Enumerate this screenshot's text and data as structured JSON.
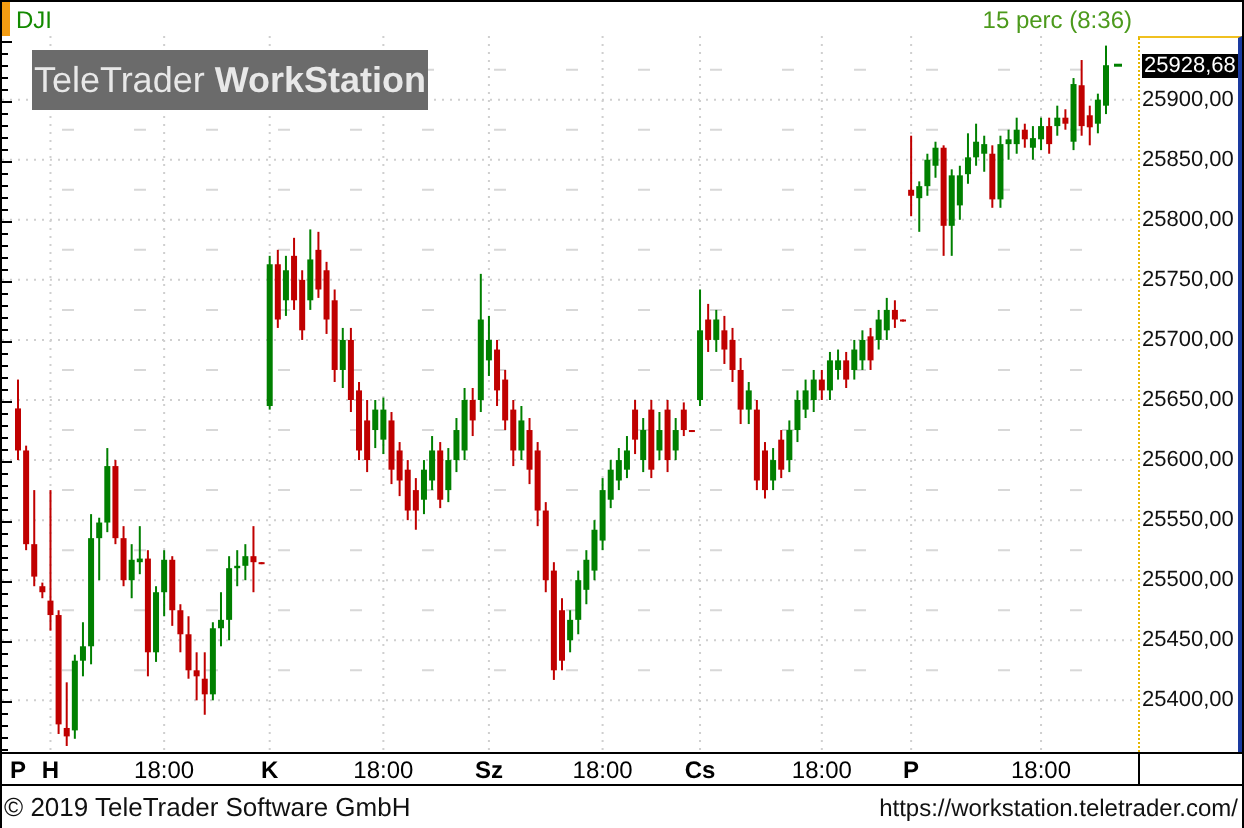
{
  "header": {
    "symbol": "DJI",
    "period": "15 perc (8:36)"
  },
  "logo": "TeleTrader **WorkStation**",
  "last_price": "25928,68",
  "chart": {
    "chart_data": {
      "type": "candlestick",
      "grid": true,
      "ylim": [
        25357,
        25953
      ],
      "yticks": [
        {
          "value": 25400,
          "label": "25400,00"
        },
        {
          "value": 25450,
          "label": "25450,00"
        },
        {
          "value": 25500,
          "label": "25500,00"
        },
        {
          "value": 25550,
          "label": "25550,00"
        },
        {
          "value": 25600,
          "label": "25600,00"
        },
        {
          "value": 25650,
          "label": "25650,00"
        },
        {
          "value": 25700,
          "label": "25700,00"
        },
        {
          "value": 25750,
          "label": "25750,00"
        },
        {
          "value": 25800,
          "label": "25800,00"
        },
        {
          "value": 25850,
          "label": "25850,00"
        },
        {
          "value": 25900,
          "label": "25900,00"
        }
      ],
      "categories": [
        "P",
        null,
        null,
        null,
        "H",
        null,
        null,
        null,
        null,
        null,
        null,
        null,
        null,
        null,
        null,
        null,
        null,
        null,
        "18:00",
        null,
        null,
        null,
        null,
        null,
        null,
        null,
        null,
        null,
        null,
        null,
        null,
        "K",
        null,
        null,
        null,
        null,
        null,
        null,
        null,
        null,
        null,
        null,
        null,
        null,
        null,
        "18:00",
        null,
        null,
        null,
        null,
        null,
        null,
        null,
        null,
        null,
        null,
        null,
        null,
        "Sz",
        null,
        null,
        null,
        null,
        null,
        null,
        null,
        null,
        null,
        null,
        null,
        null,
        null,
        "18:00",
        null,
        null,
        null,
        null,
        null,
        null,
        null,
        null,
        null,
        null,
        null,
        "Cs",
        null,
        null,
        null,
        null,
        null,
        null,
        null,
        null,
        null,
        null,
        null,
        null,
        null,
        null,
        "18:00",
        null,
        null,
        null,
        null,
        null,
        null,
        null,
        null,
        null,
        null,
        "P",
        null,
        null,
        null,
        null,
        null,
        null,
        null,
        null,
        null,
        null,
        null,
        null,
        null,
        null,
        null,
        "18:00",
        null,
        null,
        null,
        null,
        null,
        null,
        null,
        null
      ],
      "ohlc": [
        [
          25643,
          25667,
          25600,
          25608
        ],
        [
          25608,
          25612,
          25525,
          25530
        ],
        [
          25530,
          25575,
          25495,
          25503
        ],
        [
          25495,
          25498,
          25485,
          25490
        ],
        [
          25483,
          25575,
          25458,
          25471
        ],
        [
          25471,
          25475,
          25372,
          25380
        ],
        [
          25377,
          25415,
          25362,
          25370
        ],
        [
          25375,
          25438,
          25368,
          25433
        ],
        [
          25433,
          25465,
          25420,
          25445
        ],
        [
          25445,
          25555,
          25430,
          25535
        ],
        [
          25535,
          25552,
          25500,
          25548
        ],
        [
          25548,
          25610,
          25540,
          25595
        ],
        [
          25595,
          25600,
          25530,
          25535
        ],
        [
          25535,
          25545,
          25495,
          25500
        ],
        [
          25500,
          25530,
          25485,
          25517
        ],
        [
          25515,
          25545,
          25505,
          25518
        ],
        [
          25518,
          25525,
          25420,
          25440
        ],
        [
          25440,
          25495,
          25432,
          25490
        ],
        [
          25490,
          25525,
          25470,
          25517
        ],
        [
          25517,
          25520,
          25462,
          25475
        ],
        [
          25475,
          25480,
          25440,
          25455
        ],
        [
          25455,
          25470,
          25418,
          25425
        ],
        [
          25425,
          25440,
          25400,
          25420
        ],
        [
          25418,
          25440,
          25388,
          25405
        ],
        [
          25405,
          25465,
          25400,
          25460
        ],
        [
          25460,
          25490,
          25445,
          25467
        ],
        [
          25467,
          25520,
          25450,
          25510
        ],
        [
          25510,
          25525,
          25495,
          25512
        ],
        [
          25512,
          25530,
          25500,
          25520
        ],
        [
          25520,
          25545,
          25490,
          25515
        ],
        [
          25515,
          25515,
          25515,
          25515
        ],
        [
          25645,
          25770,
          25642,
          25763
        ],
        [
          25763,
          25775,
          25710,
          25717
        ],
        [
          25733,
          25770,
          25720,
          25758
        ],
        [
          25770,
          25785,
          25725,
          25733
        ],
        [
          25750,
          25758,
          25700,
          25708
        ],
        [
          25733,
          25792,
          25725,
          25767
        ],
        [
          25775,
          25790,
          25735,
          25742
        ],
        [
          25758,
          25765,
          25705,
          25717
        ],
        [
          25733,
          25742,
          25665,
          25675
        ],
        [
          25675,
          25710,
          25660,
          25700
        ],
        [
          25700,
          25710,
          25640,
          25650
        ],
        [
          25658,
          25665,
          25600,
          25608
        ],
        [
          25633,
          25650,
          25590,
          25600
        ],
        [
          25625,
          25650,
          25610,
          25642
        ],
        [
          25617,
          25652,
          25605,
          25642
        ],
        [
          25633,
          25640,
          25580,
          25592
        ],
        [
          25608,
          25615,
          25570,
          25583
        ],
        [
          25592,
          25600,
          25550,
          25558
        ],
        [
          25575,
          25585,
          25542,
          25558
        ],
        [
          25567,
          25600,
          25555,
          25592
        ],
        [
          25583,
          25620,
          25575,
          25608
        ],
        [
          25608,
          25615,
          25560,
          25567
        ],
        [
          25575,
          25610,
          25565,
          25600
        ],
        [
          25600,
          25635,
          25590,
          25625
        ],
        [
          25608,
          25660,
          25600,
          25650
        ],
        [
          25650,
          25660,
          25620,
          25633
        ],
        [
          25650,
          25755,
          25640,
          25717
        ],
        [
          25683,
          25720,
          25670,
          25700
        ],
        [
          25692,
          25700,
          25645,
          25658
        ],
        [
          25667,
          25675,
          25625,
          25633
        ],
        [
          25642,
          25650,
          25595,
          25608
        ],
        [
          25608,
          25645,
          25600,
          25633
        ],
        [
          25625,
          25635,
          25580,
          25592
        ],
        [
          25608,
          25615,
          25545,
          25558
        ],
        [
          25558,
          25565,
          25490,
          25500
        ],
        [
          25508,
          25515,
          25417,
          25425
        ],
        [
          25475,
          25485,
          25425,
          25433
        ],
        [
          25450,
          25475,
          25440,
          25467
        ],
        [
          25467,
          25508,
          25455,
          25500
        ],
        [
          25492,
          25525,
          25480,
          25517
        ],
        [
          25508,
          25550,
          25500,
          25542
        ],
        [
          25533,
          25585,
          25525,
          25575
        ],
        [
          25567,
          25600,
          25560,
          25592
        ],
        [
          25583,
          25610,
          25575,
          25600
        ],
        [
          25592,
          25620,
          25585,
          25608
        ],
        [
          25642,
          25650,
          25605,
          25617
        ],
        [
          25600,
          25635,
          25590,
          25625
        ],
        [
          25642,
          25650,
          25585,
          25592
        ],
        [
          25608,
          25640,
          25600,
          25625
        ],
        [
          25642,
          25650,
          25590,
          25600
        ],
        [
          25608,
          25635,
          25600,
          25625
        ],
        [
          25642,
          25648,
          25620,
          25625
        ],
        [
          25625,
          25625,
          25625,
          25625
        ],
        [
          25650,
          25742,
          25645,
          25708
        ],
        [
          25717,
          25730,
          25690,
          25700
        ],
        [
          25700,
          25725,
          25690,
          25717
        ],
        [
          25708,
          25720,
          25680,
          25692
        ],
        [
          25700,
          25710,
          25665,
          25675
        ],
        [
          25675,
          25685,
          25630,
          25642
        ],
        [
          25642,
          25665,
          25630,
          25658
        ],
        [
          25642,
          25650,
          25575,
          25583
        ],
        [
          25608,
          25615,
          25568,
          25575
        ],
        [
          25583,
          25610,
          25575,
          25600
        ],
        [
          25617,
          25625,
          25585,
          25592
        ],
        [
          25600,
          25633,
          25590,
          25625
        ],
        [
          25625,
          25658,
          25615,
          25650
        ],
        [
          25642,
          25667,
          25635,
          25658
        ],
        [
          25650,
          25675,
          25640,
          25667
        ],
        [
          25667,
          25675,
          25650,
          25658
        ],
        [
          25658,
          25690,
          25650,
          25683
        ],
        [
          25675,
          25692,
          25667,
          25683
        ],
        [
          25683,
          25690,
          25660,
          25667
        ],
        [
          25675,
          25700,
          25667,
          25692
        ],
        [
          25683,
          25708,
          25675,
          25700
        ],
        [
          25703,
          25710,
          25675,
          25683
        ],
        [
          25700,
          25725,
          25692,
          25717
        ],
        [
          25708,
          25735,
          25700,
          25725
        ],
        [
          25725,
          25733,
          25710,
          25717
        ],
        [
          25717,
          25717,
          25717,
          25717
        ],
        [
          25825,
          25870,
          25803,
          25820
        ],
        [
          25818,
          25832,
          25790,
          25828
        ],
        [
          25828,
          25855,
          25820,
          25850
        ],
        [
          25845,
          25865,
          25835,
          25860
        ],
        [
          25860,
          25862,
          25770,
          25795
        ],
        [
          25795,
          25842,
          25770,
          25837
        ],
        [
          25812,
          25845,
          25800,
          25837
        ],
        [
          25838,
          25872,
          25830,
          25852
        ],
        [
          25852,
          25880,
          25845,
          25865
        ],
        [
          25855,
          25870,
          25840,
          25863
        ],
        [
          25855,
          25862,
          25810,
          25817
        ],
        [
          25817,
          25870,
          25810,
          25863
        ],
        [
          25863,
          25875,
          25850,
          25867
        ],
        [
          25863,
          25885,
          25855,
          25875
        ],
        [
          25875,
          25880,
          25860,
          25867
        ],
        [
          25860,
          25878,
          25850,
          25868
        ],
        [
          25867,
          25885,
          25858,
          25878
        ],
        [
          25878,
          25885,
          25855,
          25863
        ],
        [
          25878,
          25895,
          25870,
          25885
        ],
        [
          25885,
          25892,
          25875,
          25880
        ],
        [
          25865,
          25918,
          25858,
          25913
        ],
        [
          25912,
          25933,
          25870,
          25878
        ],
        [
          25887,
          25895,
          25862,
          25877
        ],
        [
          25880,
          25905,
          25872,
          25900
        ],
        [
          25895,
          25945,
          25888,
          25928.68
        ]
      ]
    }
  },
  "footer": {
    "copyright": "© 2019 TeleTrader Software GmbH",
    "url": "https://workstation.teletrader.com/"
  }
}
